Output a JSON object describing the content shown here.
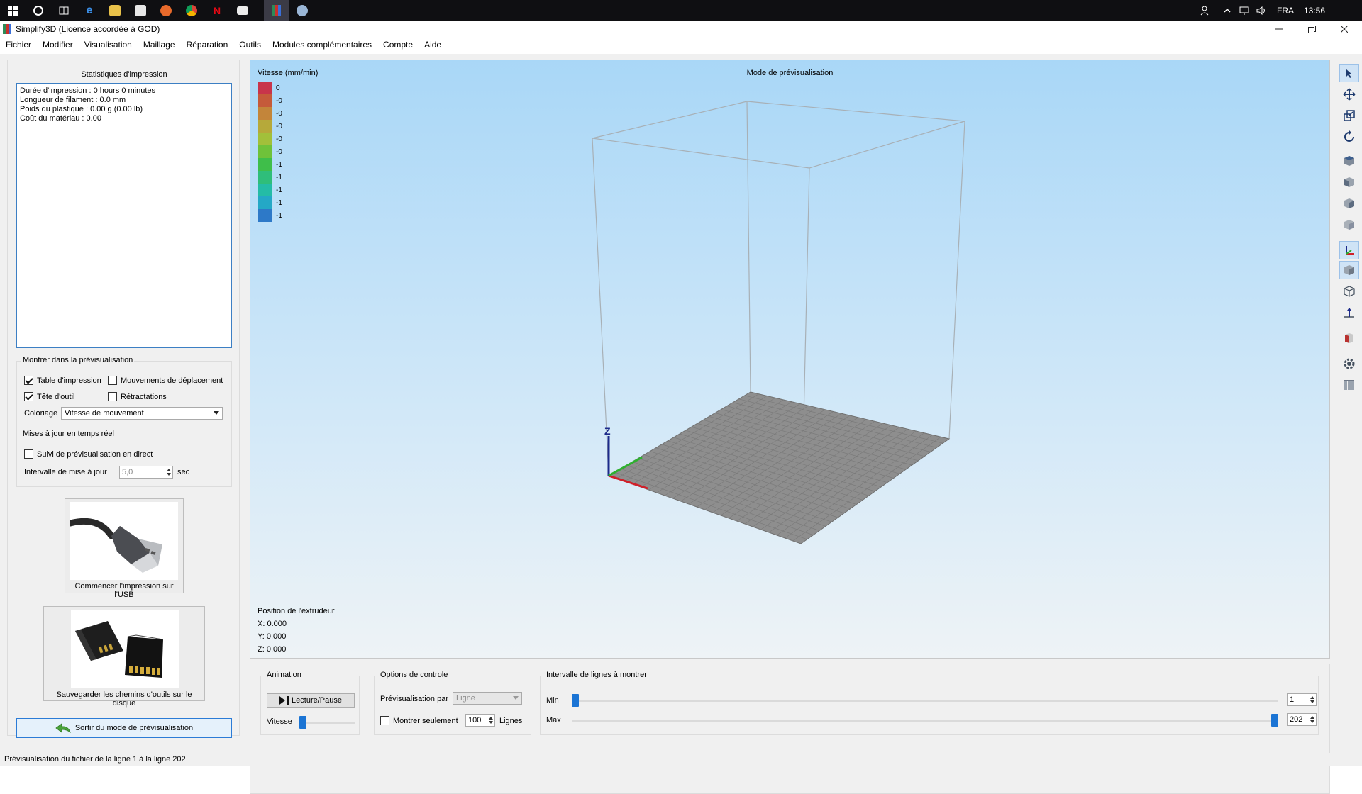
{
  "taskbar": {
    "icons": [
      "windows-start-icon",
      "cortana-circle-icon",
      "task-view-icon",
      "edge-icon",
      "file-explorer-icon",
      "store-icon",
      "firefox-icon",
      "chrome-icon",
      "netflix-icon",
      "mail-icon",
      "simplify3d-taskbar-icon",
      "app-extra-icon"
    ],
    "lang": "FRA",
    "time": "13:56"
  },
  "titlebar": {
    "title": "Simplify3D (Licence accordée à GOD)"
  },
  "menu": [
    "Fichier",
    "Modifier",
    "Visualisation",
    "Maillage",
    "Réparation",
    "Outils",
    "Modules complémentaires",
    "Compte",
    "Aide"
  ],
  "stats": {
    "title": "Statistiques d'impression",
    "lines": [
      "Durée d'impression : 0 hours 0 minutes",
      "Longueur de filament : 0.0 mm",
      "Poids du plastique : 0.00 g (0.00 lb)",
      "Coût du matériau : 0.00"
    ]
  },
  "preview_options": {
    "title": "Montrer dans la prévisualisation",
    "build_table": "Table d'impression",
    "travel_moves": "Mouvements de déplacement",
    "tool_head": "Tête d'outil",
    "retractions": "Rétractations",
    "coloring_label": "Coloriage",
    "coloring_value": "Vitesse de mouvement"
  },
  "realtime": {
    "title": "Mises à jour en temps réel",
    "follow_live": "Suivi de prévisualisation en direct",
    "interval_label": "Intervalle de mise à jour",
    "interval_value": "5,0",
    "interval_unit": "sec"
  },
  "usb": {
    "caption": "Commencer l'impression sur l'USB"
  },
  "sd": {
    "caption": "Sauvegarder les chemins d'outils sur le disque"
  },
  "exit_preview": "Sortir du mode de prévisualisation",
  "viewport": {
    "title": "Mode de prévisualisation",
    "legend_title": "Vitesse (mm/min)",
    "legend": [
      {
        "value": "0",
        "color": "#c8344a"
      },
      {
        "value": "-0",
        "color": "#c55a3a"
      },
      {
        "value": "-0",
        "color": "#c3853a"
      },
      {
        "value": "-0",
        "color": "#b6a93a"
      },
      {
        "value": "-0",
        "color": "#a2c03a"
      },
      {
        "value": "-0",
        "color": "#6fc23a"
      },
      {
        "value": "-1",
        "color": "#3fbe4a"
      },
      {
        "value": "-1",
        "color": "#2fbe7a"
      },
      {
        "value": "-1",
        "color": "#24bca6"
      },
      {
        "value": "-1",
        "color": "#24a8c6"
      },
      {
        "value": "-1",
        "color": "#2d79c8"
      }
    ],
    "axis_z": "Z",
    "extruder_title": "Position de l'extrudeur",
    "x": "X: 0.000",
    "y": "Y: 0.000",
    "z": "Z: 0.000"
  },
  "animation": {
    "title": "Animation",
    "play_label": "Lecture/Pause",
    "speed_label": "Vitesse",
    "speed_level": 0.0
  },
  "control_options": {
    "title": "Options de controle",
    "preview_by_label": "Prévisualisation par",
    "preview_by_value": "Ligne",
    "show_only_label": "Montrer seulement",
    "show_only_value": "100",
    "lines_label": "Lignes"
  },
  "line_range": {
    "title": "Intervalle de lignes à montrer",
    "min_label": "Min",
    "min_value": "1",
    "max_label": "Max",
    "max_value": "202",
    "min_level": 0.0,
    "max_level": 1.0
  },
  "right_toolbar": [
    "select-arrow-icon",
    "move-icon",
    "scale-icon",
    "rotate-icon",
    "view-top-cube-icon",
    "view-front-cube-icon",
    "view-left-cube-icon",
    "view-right-cube-icon",
    "axes-icon",
    "solid-cube-icon",
    "wireframe-cube-icon",
    "normals-icon",
    "cross-section-icon",
    "settings-gear-icon",
    "build-volume-icon"
  ],
  "status": "Prévisualisation du fichier de la ligne 1 à la ligne 202"
}
